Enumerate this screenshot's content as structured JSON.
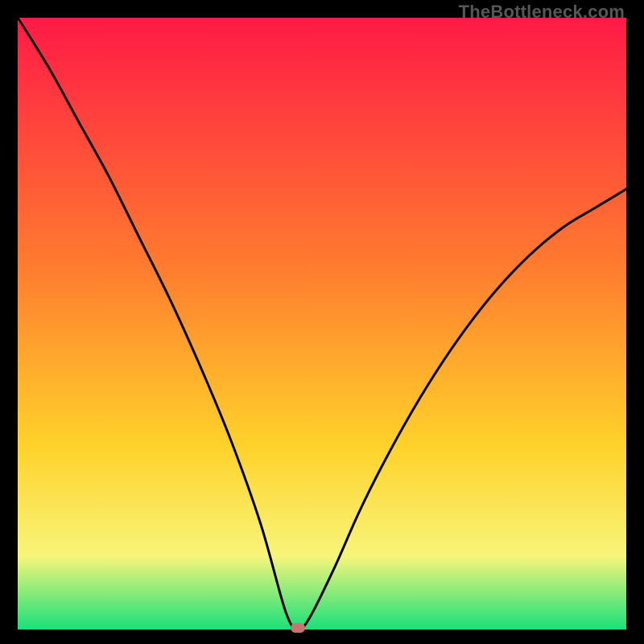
{
  "watermark": "TheBottleneck.com",
  "colors": {
    "top": "#ff1a46",
    "mid1": "#ff7a2f",
    "mid2": "#ffd22a",
    "mid3": "#f7f57a",
    "bottom": "#19e07a",
    "curve": "#000000",
    "marker": "#c9746e",
    "frame": "#000000"
  },
  "chart_data": {
    "type": "line",
    "title": "",
    "xlabel": "",
    "ylabel": "",
    "xlim": [
      0,
      100
    ],
    "ylim": [
      0,
      100
    ],
    "series": [
      {
        "name": "bottleneck-curve",
        "x": [
          0,
          5,
          10,
          15,
          20,
          25,
          30,
          35,
          40,
          44,
          46,
          48,
          52,
          56,
          60,
          65,
          70,
          75,
          80,
          85,
          90,
          95,
          100
        ],
        "values": [
          100,
          92,
          83,
          74,
          64,
          54,
          43,
          31,
          17,
          3,
          0,
          2,
          10,
          19,
          27,
          36,
          44,
          51,
          57,
          62,
          66,
          69,
          72
        ]
      }
    ],
    "marker": {
      "x": 46,
      "y": 0
    },
    "gradient_stops": [
      {
        "offset": 0.0,
        "color": "#ff1a46"
      },
      {
        "offset": 0.4,
        "color": "#ff7a2f"
      },
      {
        "offset": 0.7,
        "color": "#ffd22a"
      },
      {
        "offset": 0.88,
        "color": "#f7f57a"
      },
      {
        "offset": 1.0,
        "color": "#19e07a"
      }
    ]
  }
}
